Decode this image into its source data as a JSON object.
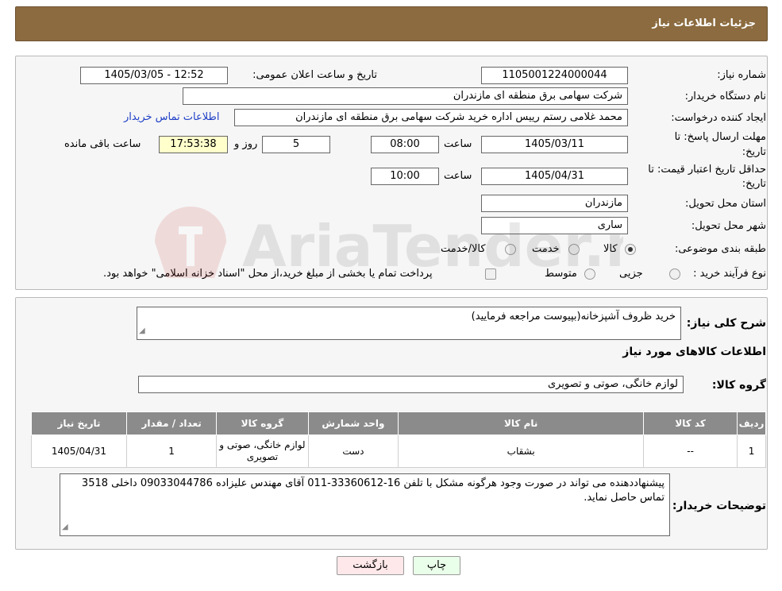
{
  "header": {
    "title": "جزئیات اطلاعات نیاز"
  },
  "form": {
    "need_number_label": "شماره نیاز:",
    "need_number": "1105001224000044",
    "announce_label": "تاریخ و ساعت اعلان عمومی:",
    "announce_value": "1405/03/05 - 12:52",
    "buyer_org_label": "نام دستگاه خریدار:",
    "buyer_org": "شرکت سهامی برق منطقه ای مازندران",
    "requester_label": "ایجاد کننده درخواست:",
    "requester": "محمد غلامی رستم رییس اداره خرید شرکت سهامی برق منطقه ای مازندران",
    "contact_link": "اطلاعات تماس خریدار",
    "deadline_label_1": "مهلت ارسال پاسخ: تا",
    "deadline_label_2": "تاریخ:",
    "deadline_date": "1405/03/11",
    "time_label": "ساعت",
    "deadline_time": "08:00",
    "days_value": "5",
    "days_label": "روز و",
    "remaining_time": "17:53:38",
    "remaining_label": "ساعت باقی مانده",
    "validity_label_1": "حداقل تاریخ اعتبار قیمت: تا",
    "validity_label_2": "تاریخ:",
    "validity_date": "1405/04/31",
    "validity_time": "10:00",
    "province_label": "استان محل تحویل:",
    "province": "مازندران",
    "city_label": "شهر محل تحویل:",
    "city": "ساری",
    "category_label": "طبقه بندی موضوعی:",
    "category_options": [
      "کالا",
      "خدمت",
      "کالا/خدمت"
    ],
    "purchase_type_label": "نوع فرآیند خرید :",
    "purchase_options": [
      "جزیی",
      "متوسط"
    ],
    "purchase_note": "پرداخت تمام یا بخشی از مبلغ خرید،از محل \"اسناد خزانه اسلامی\" خواهد بود."
  },
  "details": {
    "description_label": "شرح کلی نیاز:",
    "description": "خرید ظروف آشپزخانه(بپیوست مراجعه فرمایید)",
    "goods_info_title": "اطلاعات کالاهای مورد نیاز",
    "goods_group_label": "گروه کالا:",
    "goods_group": "لوازم خانگی، صوتی و تصویری",
    "table": {
      "headers": [
        "ردیف",
        "کد کالا",
        "نام کالا",
        "واحد شمارش",
        "گروه کالا",
        "تعداد / مقدار",
        "تاریخ نیاز"
      ],
      "rows": [
        [
          "1",
          "--",
          "بشقاب",
          "دست",
          "لوازم خانگی، صوتی و تصویری",
          "1",
          "1405/04/31"
        ]
      ]
    },
    "buyer_notes_label": "توضیحات خریدار:",
    "buyer_notes": "پیشنهاددهنده می تواند در صورت وجود هرگونه مشکل با تلفن 16-33360612-011 آقای مهندس علیزاده  09033044786 داخلی 3518 تماس حاصل نماید."
  },
  "buttons": {
    "print": "چاپ",
    "back": "بازگشت"
  },
  "watermark_text": "AriaTender.neT"
}
